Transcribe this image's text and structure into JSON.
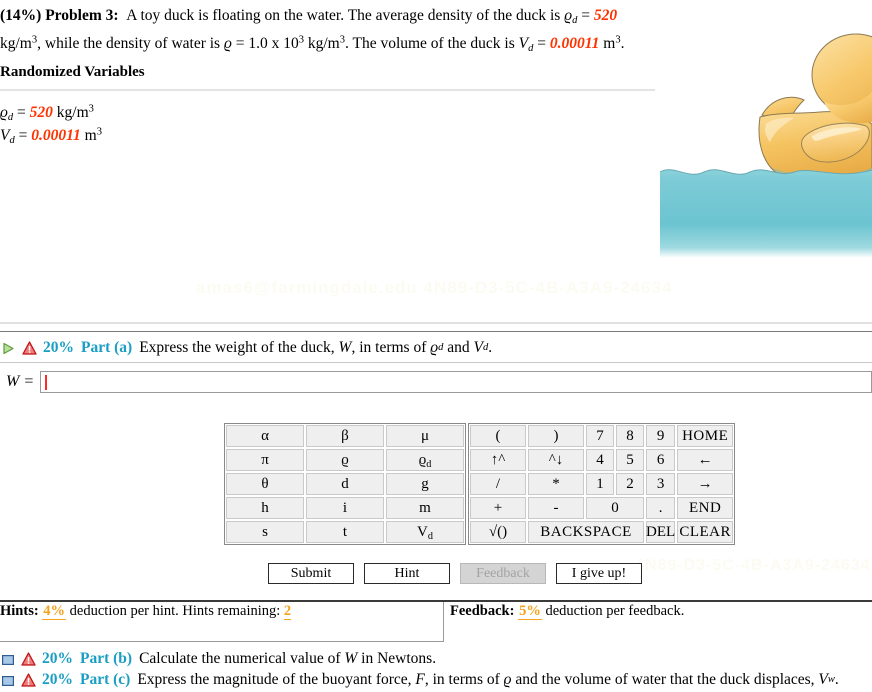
{
  "problem": {
    "percent": "(14%)",
    "number": "Problem 3:",
    "sentence1_a": "A toy duck is floating on the water. The average density of the duck is",
    "rho_d_symbol": "ϱ",
    "rho_d_sub": "d",
    "rho_d_value": "520",
    "units_kgm3_base": "kg/m",
    "units_kgm3_exp": "3",
    "sentence2": ", while the density of water is",
    "rho_symbol": "ϱ",
    "rho_value": "1.0 x 10",
    "rho_exp": "3",
    "sentence3": ". The volume of the duck is",
    "V_d_symbol": "V",
    "V_d_sub": "d",
    "V_d_value": "0.00011",
    "units_m3_base": "m",
    "units_m3_exp": "3",
    "period": "."
  },
  "randomized": {
    "title": "Randomized Variables",
    "rows": [
      {
        "symbol": "ϱ",
        "sub": "d",
        "eq": "=",
        "value": "520",
        "unit_base": "kg/m",
        "unit_exp": "3"
      },
      {
        "symbol": "V",
        "sub": "d",
        "eq": "=",
        "value": "0.00011",
        "unit_base": "m",
        "unit_exp": "3"
      }
    ]
  },
  "watermarks": {
    "top": "amas6@farmingdale.edu 4N89-D3-5C-4B-A3A9-24634",
    "bottom": "4N89-D3-5C-4B-A3A9-24634"
  },
  "figure": {
    "name": "rubber-duck-floating-on-water",
    "duck_body_color": "#f5c462",
    "duck_highlight_color": "#fbdc97",
    "duck_shadow_color": "#e0a948",
    "water_color": "#76c9d4",
    "water_deep_color": "#5cbcc9",
    "outline_color": "#8a7a5a"
  },
  "parts": {
    "a": {
      "percent": "20%",
      "label": "Part (a)",
      "text_before": "Express the weight of the duck,",
      "var1": "W",
      "text_mid": ", in terms of",
      "var2_sym": "ϱ",
      "var2_sub": "d",
      "text_and": "and",
      "var3_sym": "V",
      "var3_sub": "d",
      "text_end": ".",
      "expand_icon": "green-triangle-expand-icon",
      "warn_icon": "red-warning-triangle-icon"
    },
    "b": {
      "percent": "20%",
      "label": "Part (b)",
      "text": "Calculate the numerical value of",
      "var1": "W",
      "text_end": "in Newtons.",
      "collapse_icon": "blue-square-collapsed-icon",
      "warn_icon": "red-warning-triangle-icon"
    },
    "c": {
      "percent": "20%",
      "label": "Part (c)",
      "text_before": "Express the magnitude of the buoyant force,",
      "var1": "F",
      "text_mid": ", in terms of",
      "var2_sym": "ϱ",
      "text_mid2": "and the volume of water that the duck displaces,",
      "var3_sym": "V",
      "var3_sub": "w",
      "text_end": "."
    }
  },
  "answer": {
    "variable": "W",
    "equals": "=",
    "value": "",
    "caret_color": "#ff2a2a"
  },
  "keypad": {
    "symbols": [
      [
        "α",
        "β",
        "μ"
      ],
      [
        "π",
        "ϱ",
        "ϱₓ"
      ],
      [
        "θ",
        "d",
        "g"
      ],
      [
        "h",
        "i",
        "m"
      ],
      [
        "s",
        "t",
        "Vₓ"
      ]
    ],
    "symbols_detail": [
      [
        {
          "t": "α"
        },
        {
          "t": "β"
        },
        {
          "t": "μ"
        }
      ],
      [
        {
          "t": "π"
        },
        {
          "t": "ϱ"
        },
        {
          "t": "ϱ",
          "sub": "d"
        }
      ],
      [
        {
          "t": "θ"
        },
        {
          "t": "d"
        },
        {
          "t": "g"
        }
      ],
      [
        {
          "t": "h"
        },
        {
          "t": "i"
        },
        {
          "t": "m"
        }
      ],
      [
        {
          "t": "s"
        },
        {
          "t": "t"
        },
        {
          "t": "V",
          "sub": "d"
        }
      ]
    ],
    "numeric": {
      "row1": [
        "(",
        ")",
        "7",
        "8",
        "9",
        "HOME"
      ],
      "row2": [
        "↑^",
        "^↓",
        "4",
        "5",
        "6",
        "←"
      ],
      "row3": [
        "/",
        "*",
        "1",
        "2",
        "3",
        "→"
      ],
      "row4": [
        "+",
        "-",
        "0",
        ".",
        "END"
      ],
      "row5": [
        "√()",
        "BACKSPACE",
        "DEL",
        "CLEAR"
      ]
    },
    "disabled_keys": [
      ")",
      "↑^",
      "^↓",
      "/",
      "*",
      "HOME",
      "←",
      "→",
      "END",
      "BACKSPACE",
      "DEL",
      "CLEAR"
    ]
  },
  "actions": {
    "submit": "Submit",
    "hint": "Hint",
    "feedback": "Feedback",
    "give_up": "I give up!",
    "feedback_disabled": true
  },
  "info": {
    "hints_label": "Hints:",
    "hints_pct": "4%",
    "hints_text": "deduction per hint. Hints remaining:",
    "hints_remaining": "2",
    "feedback_label": "Feedback:",
    "feedback_pct": "5%",
    "feedback_text": "deduction per feedback."
  }
}
